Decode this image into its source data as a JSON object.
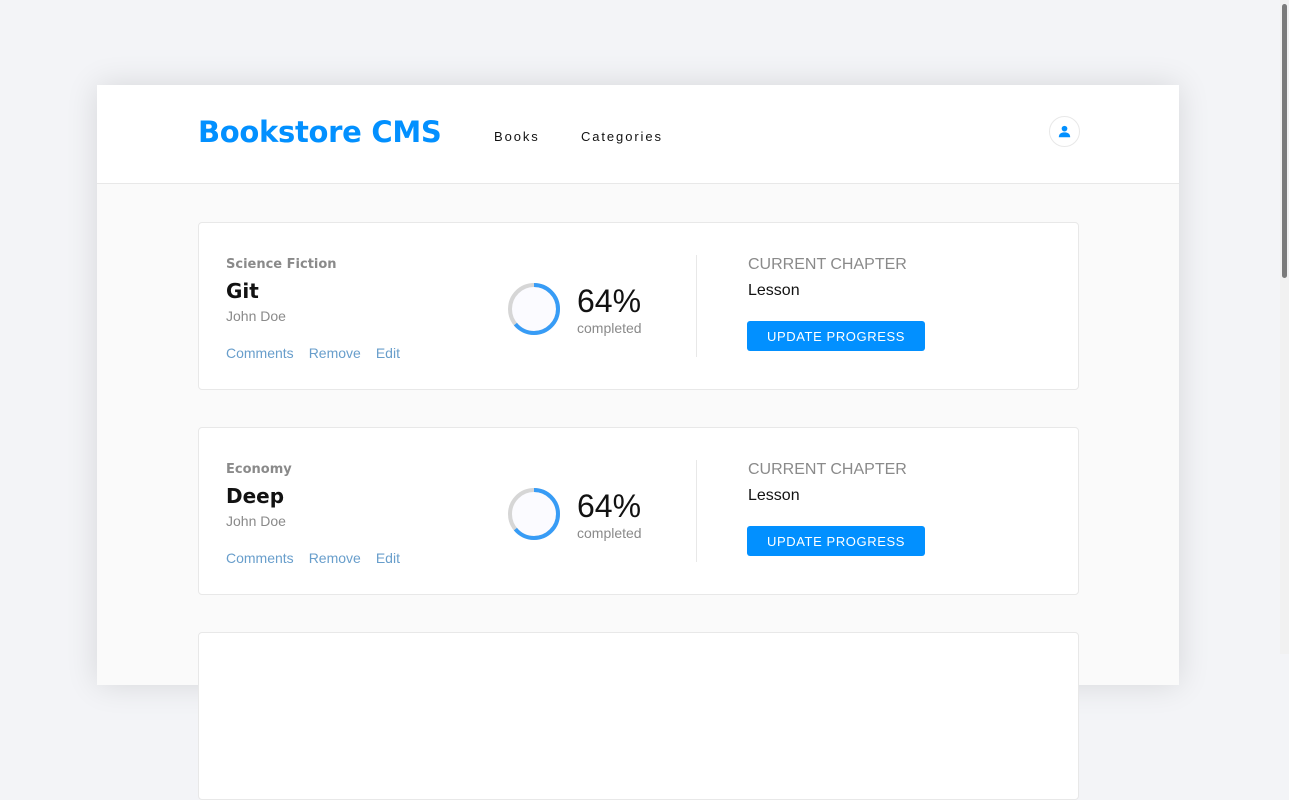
{
  "header": {
    "logo": "Bookstore CMS",
    "nav": [
      "Books",
      "Categories"
    ]
  },
  "colors": {
    "accent": "#0290ff",
    "progress": "#379cf6",
    "background": "#fafafa"
  },
  "books": [
    {
      "genre": "Science Fiction",
      "title": "Git",
      "author": "John Doe",
      "actions": [
        "Comments",
        "Remove",
        "Edit"
      ],
      "progress": {
        "percent_label": "64%",
        "value": 0.64,
        "caption": "completed"
      },
      "chapter": {
        "heading": "CURRENT CHAPTER",
        "name": "Lesson"
      },
      "button": "UPDATE PROGRESS"
    },
    {
      "genre": "Economy",
      "title": "Deep",
      "author": "John Doe",
      "actions": [
        "Comments",
        "Remove",
        "Edit"
      ],
      "progress": {
        "percent_label": "64%",
        "value": 0.64,
        "caption": "completed"
      },
      "chapter": {
        "heading": "CURRENT CHAPTER",
        "name": "Lesson"
      },
      "button": "UPDATE PROGRESS"
    }
  ]
}
